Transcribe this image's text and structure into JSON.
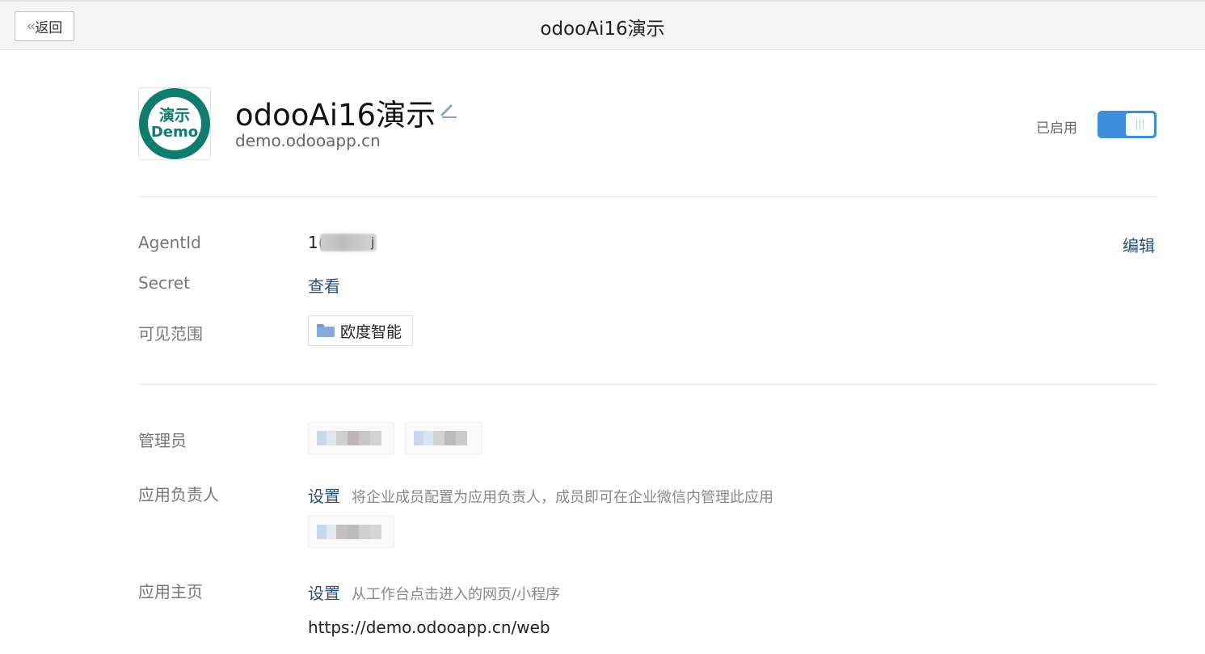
{
  "topbar": {
    "back_label": "返回",
    "title": "odooAi16演示"
  },
  "app": {
    "logo_line1": "演示",
    "logo_line2": "Demo",
    "name": "odooAi16演示",
    "domain": "demo.odooapp.cn",
    "enabled_label": "已启用",
    "enabled": true
  },
  "details": {
    "agentid_label": "AgentId",
    "agentid_value_visible": "1(",
    "agentid_suffix_visible": "j",
    "edit_label": "编辑",
    "secret_label": "Secret",
    "secret_action": "查看",
    "visibility_label": "可见范围",
    "visibility_dept": "欧度智能"
  },
  "admin": {
    "admins_label": "管理员",
    "owner_label": "应用负责人",
    "owner_action": "设置",
    "owner_desc": "将企业成员配置为应用负责人，成员即可在企业微信内管理此应用",
    "homepage_label": "应用主页",
    "homepage_action": "设置",
    "homepage_desc": "从工作台点击进入的网页/小程序",
    "homepage_url": "https://demo.odooapp.cn/web"
  },
  "colors": {
    "accent_blue": "#3e8edc",
    "link": "#2a4f7d",
    "logo_green": "#0f7d6d"
  },
  "icons": {
    "back": "double-chevron-left-icon",
    "edit": "pencil-icon",
    "folder": "folder-icon"
  }
}
